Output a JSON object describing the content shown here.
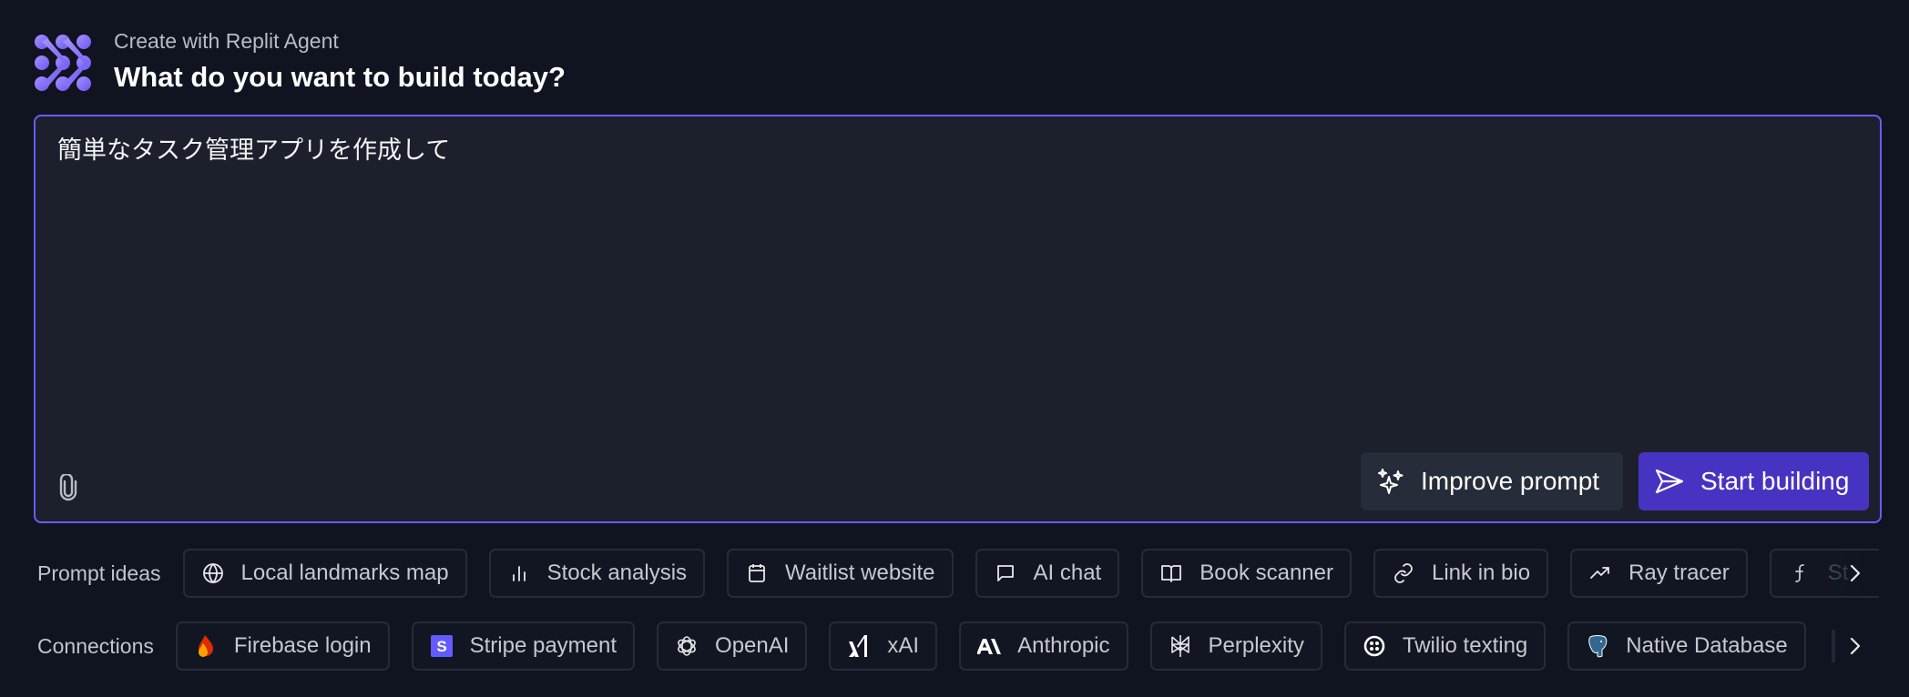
{
  "header": {
    "subtitle": "Create with Replit Agent",
    "title": "What do you want to build today?",
    "logo_icon": "replit-agent-logo-icon"
  },
  "composer": {
    "value": "簡単なタスク管理アプリを作成して",
    "attach_icon": "paperclip-icon",
    "improve_label": "Improve prompt",
    "improve_icon": "sparkles-icon",
    "start_label": "Start building",
    "start_icon": "send-icon"
  },
  "prompt_ideas": {
    "label": "Prompt ideas",
    "items": [
      {
        "label": "Local landmarks map",
        "icon": "globe-icon"
      },
      {
        "label": "Stock analysis",
        "icon": "bar-chart-icon"
      },
      {
        "label": "Waitlist website",
        "icon": "calendar-icon"
      },
      {
        "label": "AI chat",
        "icon": "chat-bubble-icon"
      },
      {
        "label": "Book scanner",
        "icon": "book-open-icon"
      },
      {
        "label": "Link in bio",
        "icon": "link-icon"
      },
      {
        "label": "Ray tracer",
        "icon": "trending-up-icon"
      },
      {
        "label": "St",
        "icon": "function-icon"
      }
    ],
    "next_icon": "chevron-right-icon"
  },
  "connections": {
    "label": "Connections",
    "items": [
      {
        "label": "Firebase login",
        "icon": "firebase-icon"
      },
      {
        "label": "Stripe payment",
        "icon": "stripe-icon"
      },
      {
        "label": "OpenAI",
        "icon": "openai-icon"
      },
      {
        "label": "xAI",
        "icon": "xai-icon"
      },
      {
        "label": "Anthropic",
        "icon": "anthropic-icon"
      },
      {
        "label": "Perplexity",
        "icon": "perplexity-icon"
      },
      {
        "label": "Twilio texting",
        "icon": "twilio-icon"
      },
      {
        "label": "Native Database",
        "icon": "postgres-elephant-icon"
      }
    ],
    "next_icon": "chevron-right-icon"
  },
  "colors": {
    "background": "#0f1420",
    "composer_bg": "#1b202c",
    "accent_border": "#6b5cf6",
    "primary_button": "#4733c2",
    "secondary_button": "#272c3b"
  }
}
